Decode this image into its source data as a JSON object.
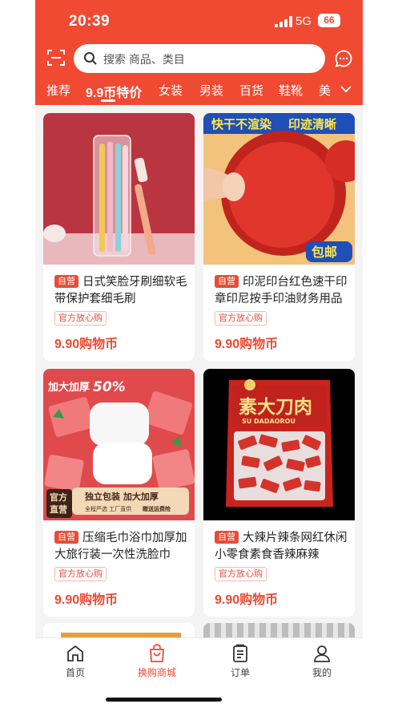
{
  "status_bar": {
    "time": "20:39",
    "network": "5G",
    "battery": "66"
  },
  "search": {
    "placeholder": "搜索 商品、类目"
  },
  "categories": [
    {
      "label": "推荐",
      "active": false
    },
    {
      "label": "9.9币特价",
      "active": true
    },
    {
      "label": "女装",
      "active": false
    },
    {
      "label": "男装",
      "active": false
    },
    {
      "label": "百货",
      "active": false
    },
    {
      "label": "鞋靴",
      "active": false
    },
    {
      "label": "美",
      "active": false
    }
  ],
  "products": [
    {
      "tag": "自营",
      "title": "日式笑脸牙刷细软毛带保护套细毛刷",
      "badge": "官方放心购",
      "price": "9.90购物币",
      "image": {
        "overlays": []
      }
    },
    {
      "tag": "自营",
      "title": "印泥印台红色速干印章印尼按手印油财务用品",
      "badge": "官方放心购",
      "price": "9.90购物币",
      "image": {
        "overlays": [
          "快干不渲染",
          "印迹清晰",
          "包邮"
        ]
      }
    },
    {
      "tag": "自营",
      "title": "压缩毛巾浴巾加厚加大旅行装一次性洗脸巾",
      "badge": "官方放心购",
      "price": "9.90购物币",
      "image": {
        "overlays": [
          "加大加厚",
          "50%",
          "独立包装 加大加厚",
          "全程严选 工厂直供",
          "赠送运费险",
          "官方",
          "直营"
        ]
      }
    },
    {
      "tag": "自营",
      "title": "大辣片辣条网红休闲小零食素食香辣麻辣",
      "badge": "官方放心购",
      "price": "9.90购物币",
      "image": {
        "overlays": [
          "素大刀肉",
          "SU DADAOROU"
        ]
      }
    }
  ],
  "tabbar": [
    {
      "label": "首页",
      "icon": "home-icon",
      "active": false
    },
    {
      "label": "换购商城",
      "icon": "shopping-bag-icon",
      "active": true
    },
    {
      "label": "订单",
      "icon": "order-list-icon",
      "active": false
    },
    {
      "label": "我的",
      "icon": "profile-icon",
      "active": false
    }
  ],
  "colors": {
    "brand": "#f04a32",
    "price": "#e94b35",
    "active_tab": "#f04a32"
  }
}
